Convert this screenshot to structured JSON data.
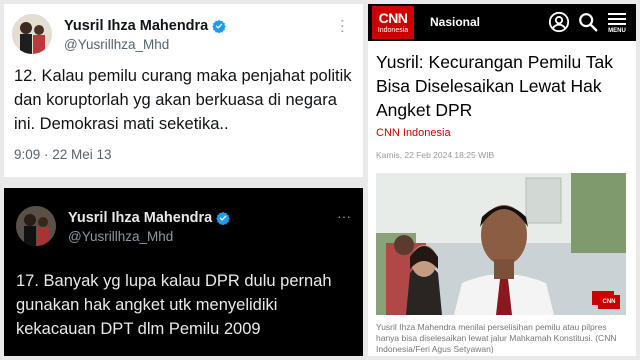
{
  "tweet1": {
    "name": "Yusril Ihza Mahendra",
    "handle": "@Yusrillhza_Mhd",
    "body": "12. Kalau pemilu curang maka penjahat politik dan koruptorlah yg akan berkuasa di negara ini. Demokrasi mati seketika..",
    "timestamp": "9:09 · 22 Mei 13",
    "more_icon": "more-icon",
    "verified_icon": "verified-badge-icon"
  },
  "tweet2": {
    "name": "Yusril Ihza Mahendra",
    "handle": "@Yusrillhza_Mhd",
    "body": "17. Banyak yg lupa kalau DPR dulu pernah gunakan hak angket utk menyelidiki kekacauan DPT dlm Pemilu 2009",
    "more_icon": "more-icon",
    "verified_icon": "verified-badge-icon"
  },
  "cnn": {
    "logo_text": "CNN",
    "logo_sub": "Indonesia",
    "section": "Nasional",
    "menu_label": "MENU",
    "title": "Yusril: Kecurangan Pemilu Tak Bisa Diselesaikan Lewat Hak Angket DPR",
    "source": "CNN Indonesia",
    "date": "Kamis, 22 Feb 2024 18:25 WIB",
    "watermark": "CNN",
    "caption": "Yusril Ihza Mahendra menilai perselisihan pemilu atau pilpres hanya bisa diselesaikan lewat jalur Mahkamah Konstitusi. (CNN Indonesia/Feri Agus Setyawan)"
  },
  "colors": {
    "twitter_blue": "#1d9bf0",
    "cnn_red": "#cc0000",
    "dark_bg": "#000000"
  }
}
